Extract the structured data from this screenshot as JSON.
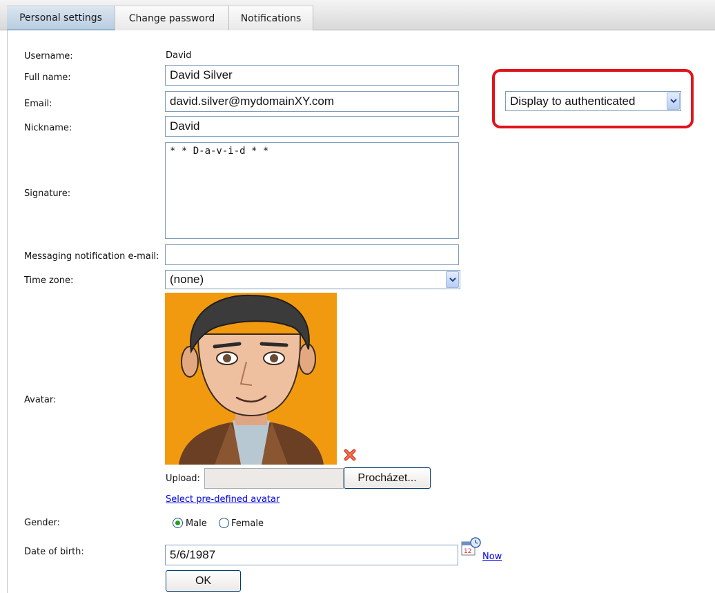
{
  "tabs": [
    {
      "label": "Personal settings",
      "active": true
    },
    {
      "label": "Change password",
      "active": false
    },
    {
      "label": "Notifications",
      "active": false
    }
  ],
  "form": {
    "username_label": "Username:",
    "username_value": "David",
    "fullname_label": "Full name:",
    "fullname_value": "David Silver",
    "email_label": "Email:",
    "email_value": "david.silver@mydomainXY.com",
    "email_visibility": "Display to authenticated",
    "nickname_label": "Nickname:",
    "nickname_value": "David",
    "signature_label": "Signature:",
    "signature_value": "* * D-a-v-i-d * *",
    "messaging_label": "Messaging notification e-mail:",
    "messaging_value": "",
    "timezone_label": "Time zone:",
    "timezone_value": "(none)",
    "avatar_label": "Avatar:",
    "upload_label": "Upload:",
    "browse_label": "Procházet...",
    "predefined_link": "Select pre-defined avatar",
    "gender_label": "Gender:",
    "gender_male": "Male",
    "gender_female": "Female",
    "gender_selected": "Male",
    "dob_label": "Date of birth:",
    "dob_value": "5/6/1987",
    "now_link": "Now",
    "ok_label": "OK"
  },
  "icons": {
    "dropdown": "chevron-down-icon",
    "delete": "delete-x-icon",
    "calendar": "calendar-icon"
  },
  "colors": {
    "highlight": "#e0141a",
    "active_tab": "#c4d6e8",
    "link": "#0000ee",
    "input_border": "#7f9db9"
  }
}
